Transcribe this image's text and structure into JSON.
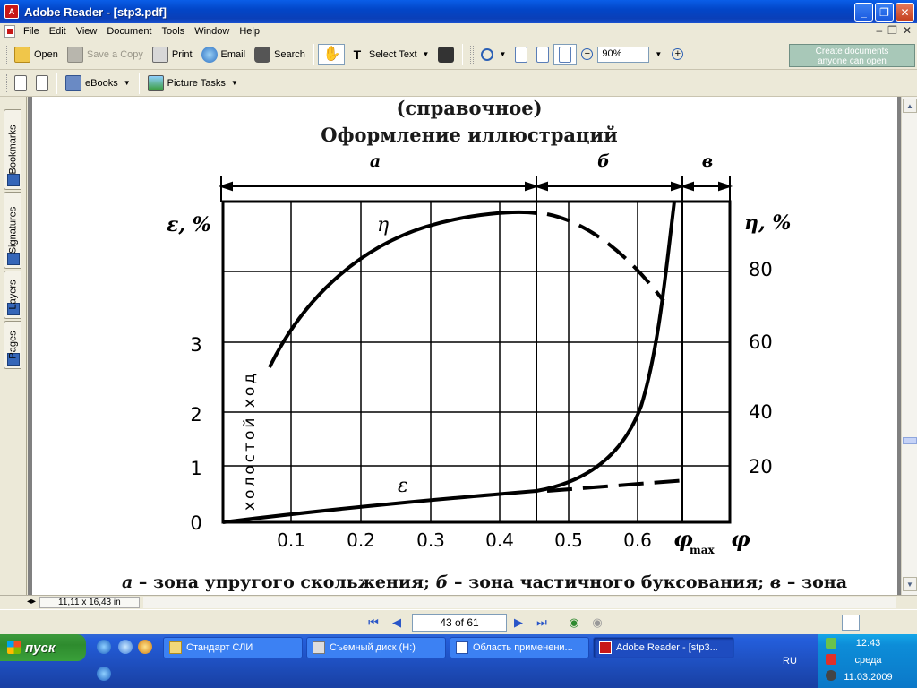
{
  "window": {
    "title": "Adobe Reader - [stp3.pdf]",
    "app_icon": "adobe-reader-icon"
  },
  "menu": [
    "File",
    "Edit",
    "View",
    "Document",
    "Tools",
    "Window",
    "Help"
  ],
  "toolbar1": {
    "open": "Open",
    "save_copy": "Save a Copy",
    "print": "Print",
    "email": "Email",
    "search": "Search",
    "select_text": "Select Text",
    "zoom": "90%",
    "create_docs_line1": "Create documents",
    "create_docs_line2": "anyone can open"
  },
  "toolbar2": {
    "ebooks": "eBooks",
    "picture_tasks": "Picture Tasks"
  },
  "side_tabs": [
    "Bookmarks",
    "Signatures",
    "Layers",
    "Pages"
  ],
  "document": {
    "heading1": "(справочное)",
    "heading2": "Оформление иллюстраций",
    "zones": [
      "а",
      "б",
      "в"
    ],
    "y_left_label": "ε, %",
    "y_right_label": "η, %",
    "y_left_ticks": [
      "0",
      "1",
      "2",
      "3"
    ],
    "y_right_ticks": [
      "20",
      "40",
      "60",
      "80"
    ],
    "x_ticks": [
      "0.1",
      "0.2",
      "0.3",
      "0.4",
      "0.5",
      "0.6"
    ],
    "x_max_label": "φ",
    "x_max_sub": "max",
    "x_label": "φ",
    "curve_eta": "η",
    "curve_eps": "ε",
    "idle_label": "холостой ход",
    "caption_parts": [
      "а",
      " – зона упругого скольжения; ",
      "б",
      " – зона частичного буксования; ",
      "в",
      " – зона"
    ]
  },
  "status": {
    "page_size": "11,11 x 16,43 in"
  },
  "navigation": {
    "page": "43 of 61"
  },
  "taskbar": {
    "start": "пуск",
    "tasks": [
      "Стандарт СЛИ",
      "Съемный диск (H:)",
      "Область применени...",
      "Adobe Reader - [stp3..."
    ],
    "lang": "RU",
    "time": "12:43",
    "day": "среда",
    "date": "11.03.2009"
  }
}
